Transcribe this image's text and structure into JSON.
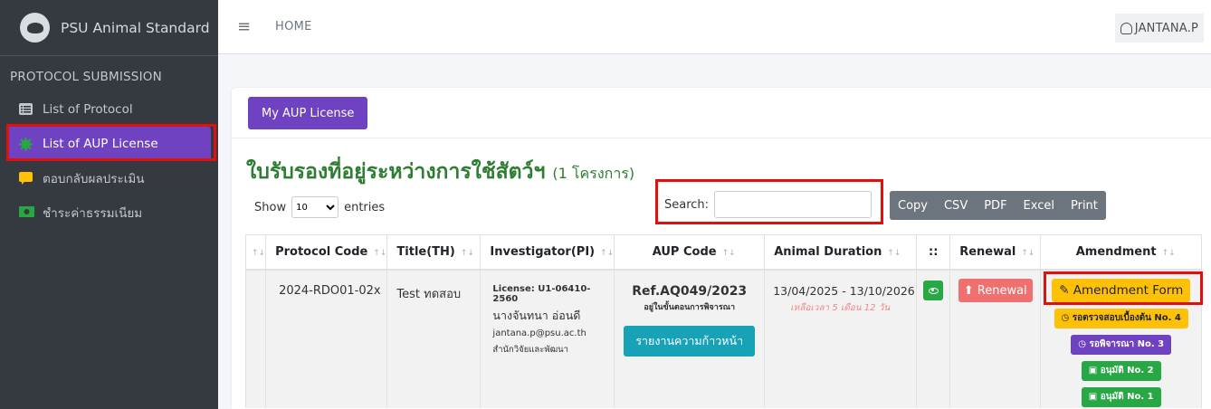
{
  "brand": {
    "name": "PSU Animal Standard"
  },
  "sidebar": {
    "header": "PROTOCOL SUBMISSION",
    "items": [
      {
        "label": "List of Protocol",
        "icon": "list-icon",
        "active": false
      },
      {
        "label": "List of AUP License",
        "icon": "gear-icon",
        "active": true
      },
      {
        "label": "ตอบกลับผลประเมิน",
        "icon": "comment-icon",
        "active": false
      },
      {
        "label": "ชำระค่าธรรมเนียม",
        "icon": "money-icon",
        "active": false
      }
    ]
  },
  "topbar": {
    "home": "HOME",
    "user": "JANTANA.P"
  },
  "main": {
    "my_aup_button": "My AUP License",
    "title": "ใบรับรองที่อยู่ระหว่างการใช้สัตว์ฯ",
    "title_count": "(1 โครงการ)",
    "show_label": "Show",
    "entries_value": "10",
    "entries_label": "entries",
    "search_label": "Search:",
    "search_value": "",
    "export_buttons": [
      "Copy",
      "CSV",
      "PDF",
      "Excel",
      "Print"
    ]
  },
  "table": {
    "headers": [
      "Protocol Code",
      "Title(TH)",
      "Investigator(PI)",
      "AUP Code",
      "Animal Duration",
      "::",
      "Renewal",
      "Amendment"
    ],
    "row": {
      "protocol_code": "2024-RDO01-02x",
      "title_th": "Test ทดสอบ",
      "license": "License: U1-06410-2560",
      "pi_name": "นางจันทนา อ่อนดี",
      "pi_email": "jantana.p@psu.ac.th",
      "pi_dept": "สำนักวิจัยและพัฒนา",
      "aup_code": "Ref.AQ049/2023",
      "aup_status": "อยู่ในขั้นตอนการพิจารณา",
      "report_button": "รายงานความก้าวหน้า",
      "duration": "13/04/2025 - 13/10/2026",
      "remaining": "เหลือเวลา 5 เดือน 12 วัน",
      "renewal_button": "Renewal",
      "amendment_button": "Amendment Form",
      "statuses": [
        {
          "label": "รอตรวจสอบเบื้องต้น No. 4",
          "color": "#ffc107",
          "icon": "clock-icon"
        },
        {
          "label": "รอพิจารณา No. 3",
          "color": "#6f42c1",
          "icon": "clock-icon"
        },
        {
          "label": "อนุมัติ No. 2",
          "color": "#28a745",
          "icon": "calendar-check-icon"
        },
        {
          "label": "อนุมัติ No. 1",
          "color": "#28a745",
          "icon": "calendar-check-icon"
        }
      ]
    }
  },
  "colors": {
    "sidebar": "#343a40",
    "accent": "#6f42c1",
    "title": "#2e7d32",
    "highlight": "#e0110d"
  }
}
